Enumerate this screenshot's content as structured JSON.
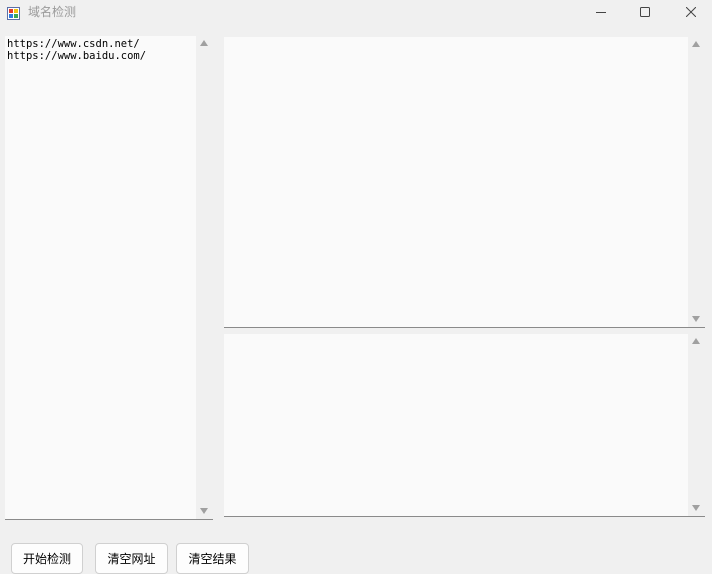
{
  "window": {
    "title": "域名检测",
    "icons": {
      "app": "app-icon",
      "minimize": "minimize-icon",
      "maximize": "maximize-icon",
      "close": "close-icon"
    }
  },
  "url_list": {
    "lines": [
      "https://www.csdn.net/",
      "https://www.baidu.com/"
    ]
  },
  "results_top": {
    "text": ""
  },
  "results_bottom": {
    "text": ""
  },
  "buttons": {
    "start": "开始检测",
    "clear_urls": "清空网址",
    "clear_results": "清空结果"
  }
}
